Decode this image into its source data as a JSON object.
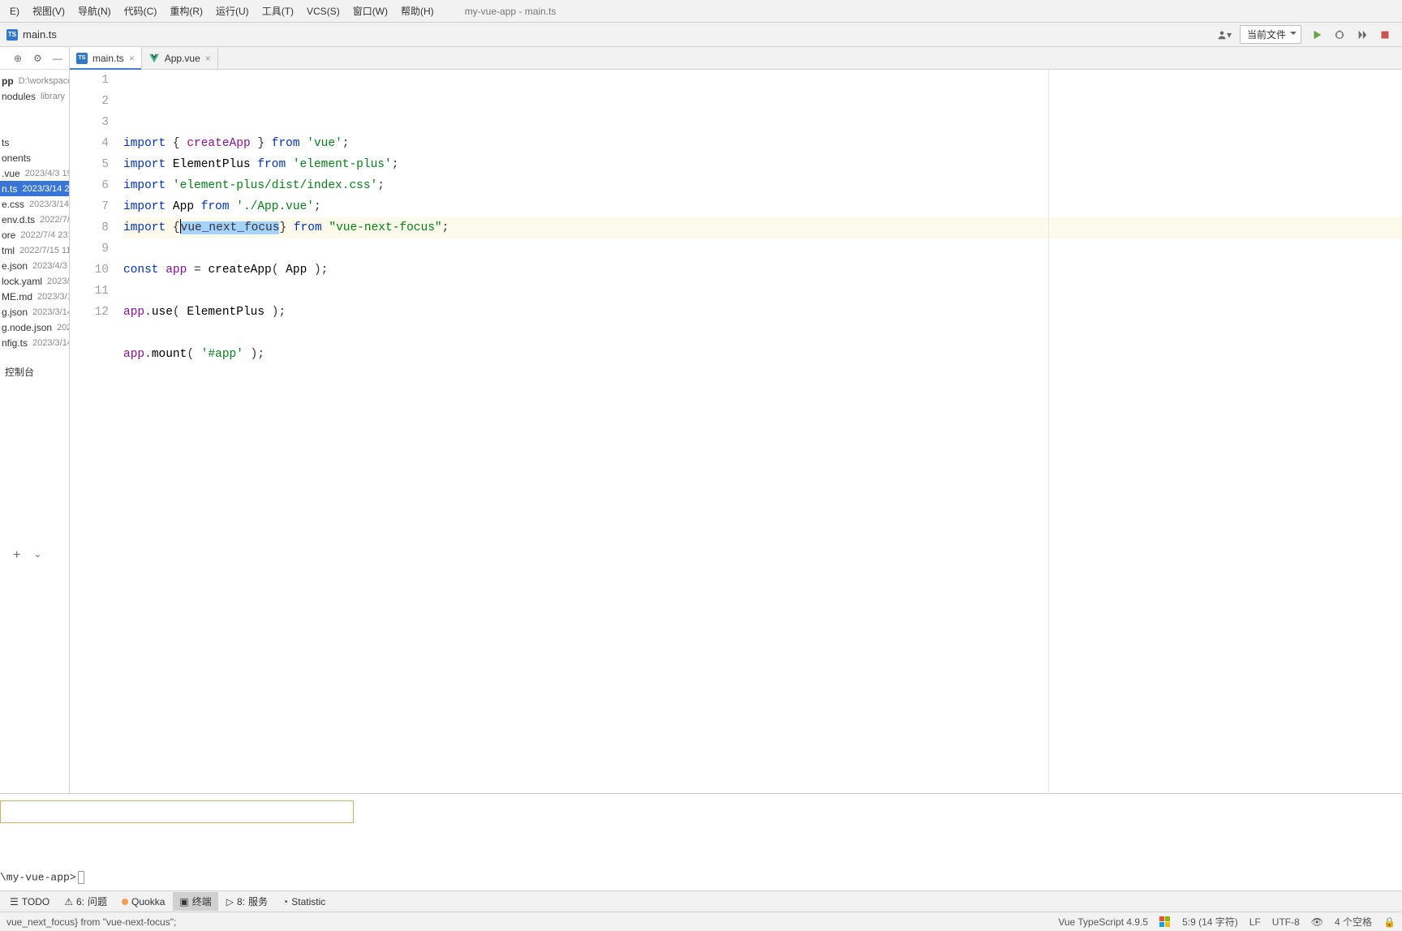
{
  "menubar": {
    "items": [
      "视图(V)",
      "导航(N)",
      "代码(C)",
      "重构(R)",
      "运行(U)",
      "工具(T)",
      "VCS(S)",
      "窗口(W)",
      "帮助(H)"
    ],
    "title": "my-vue-app - main.ts"
  },
  "navrow": {
    "filename": "main.ts",
    "run_config": "当前文件"
  },
  "sidebar": {
    "project_label": "pp",
    "project_path": "D:\\workspace",
    "libs": [
      "nodules",
      "library"
    ],
    "files": [
      {
        "name": "ts",
        "meta": ""
      },
      {
        "name": "onents",
        "meta": ""
      },
      {
        "name": ".vue",
        "meta": "2023/4/3 19"
      },
      {
        "name": "n.ts",
        "meta": "2023/3/14 22",
        "selected": true
      },
      {
        "name": "e.css",
        "meta": "2023/3/14 2"
      },
      {
        "name": "env.d.ts",
        "meta": "2022/7/"
      },
      {
        "name": "ore",
        "meta": "2022/7/4 23:0"
      },
      {
        "name": "tml",
        "meta": "2022/7/15 11"
      },
      {
        "name": "e.json",
        "meta": "2023/4/3"
      },
      {
        "name": "lock.yaml",
        "meta": "2023/3/14"
      },
      {
        "name": "ME.md",
        "meta": "2023/3/14"
      },
      {
        "name": "g.json",
        "meta": "2023/3/14"
      },
      {
        "name": "g.node.json",
        "meta": "202"
      },
      {
        "name": "nfig.ts",
        "meta": "2023/3/14"
      }
    ],
    "console": "控制台"
  },
  "tabs": [
    {
      "label": "main.ts",
      "type": "ts",
      "active": true,
      "modified": true
    },
    {
      "label": "App.vue",
      "type": "vue",
      "active": false,
      "modified": false
    }
  ],
  "code": {
    "lines": [
      {
        "n": 1,
        "tokens": [
          [
            "k-blue",
            "import "
          ],
          [
            "k-gray",
            "{ "
          ],
          [
            "k-purple",
            "createApp"
          ],
          [
            "k-gray",
            " } "
          ],
          [
            "k-blue",
            "from "
          ],
          [
            "k-green",
            "'vue'"
          ],
          [
            "k-gray",
            ";"
          ]
        ]
      },
      {
        "n": 2,
        "tokens": [
          [
            "k-blue",
            "import "
          ],
          [
            "k-ident",
            "ElementPlus "
          ],
          [
            "k-blue",
            "from "
          ],
          [
            "k-green",
            "'element-plus'"
          ],
          [
            "k-gray",
            ";"
          ]
        ]
      },
      {
        "n": 3,
        "tokens": [
          [
            "k-blue",
            "import "
          ],
          [
            "k-green",
            "'element-plus/dist/index.css'"
          ],
          [
            "k-gray",
            ";"
          ]
        ]
      },
      {
        "n": 4,
        "tokens": [
          [
            "k-blue",
            "import "
          ],
          [
            "k-ident",
            "App "
          ],
          [
            "k-blue",
            "from "
          ],
          [
            "k-green",
            "'./App.vue'"
          ],
          [
            "k-gray",
            ";"
          ]
        ]
      },
      {
        "n": 5,
        "hl": true,
        "tokens": [
          [
            "k-blue",
            "import "
          ],
          [
            "k-gray",
            "{"
          ],
          [
            "caret",
            ""
          ],
          [
            "selected",
            "vue_next_focus"
          ],
          [
            "k-gray",
            "} "
          ],
          [
            "k-blue",
            "from "
          ],
          [
            "k-green",
            "\"vue-next-focus\""
          ],
          [
            "k-gray",
            ";"
          ]
        ]
      },
      {
        "n": 6,
        "tokens": []
      },
      {
        "n": 7,
        "tokens": [
          [
            "k-blue",
            "const "
          ],
          [
            "k-purple",
            "app"
          ],
          [
            "k-gray",
            " = "
          ],
          [
            "k-ident",
            "createApp"
          ],
          [
            "k-gray",
            "( "
          ],
          [
            "k-ident",
            "App"
          ],
          [
            "k-gray",
            " );"
          ]
        ]
      },
      {
        "n": 8,
        "tokens": []
      },
      {
        "n": 9,
        "tokens": [
          [
            "k-purple",
            "app"
          ],
          [
            "k-gray",
            "."
          ],
          [
            "k-ident",
            "use"
          ],
          [
            "k-gray",
            "( "
          ],
          [
            "k-ident",
            "ElementPlus"
          ],
          [
            "k-gray",
            " );"
          ]
        ]
      },
      {
        "n": 10,
        "tokens": []
      },
      {
        "n": 11,
        "tokens": [
          [
            "k-purple",
            "app"
          ],
          [
            "k-gray",
            "."
          ],
          [
            "k-ident",
            "mount"
          ],
          [
            "k-gray",
            "( "
          ],
          [
            "k-green",
            "'#app'"
          ],
          [
            "k-gray",
            " );"
          ]
        ]
      },
      {
        "n": 12,
        "tokens": []
      }
    ]
  },
  "terminal": {
    "prompt": "\\my-vue-app>"
  },
  "bottom_tools": [
    {
      "label": "TODO",
      "icon": "list"
    },
    {
      "label": "问题",
      "icon": "warn",
      "prefix": "6:"
    },
    {
      "label": "Quokka",
      "icon": "quokka"
    },
    {
      "label": "终端",
      "icon": "terminal",
      "active": true
    },
    {
      "label": "服务",
      "icon": "run",
      "prefix": "8:"
    },
    {
      "label": "Statistic",
      "icon": "stat"
    }
  ],
  "statusbar": {
    "left": "vue_next_focus} from \"vue-next-focus\";",
    "lang": "Vue TypeScript 4.9.5",
    "pos": "5:9 (14 字符)",
    "eol": "LF",
    "enc": "UTF-8",
    "indent": "4 个空格"
  }
}
